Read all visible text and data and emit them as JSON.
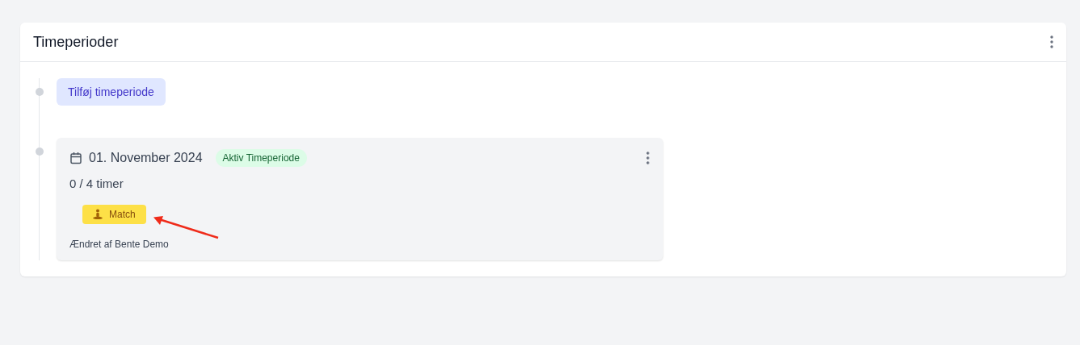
{
  "panel": {
    "title": "Timeperioder"
  },
  "add_button": {
    "label": "Tilføj timeperiode"
  },
  "periods": [
    {
      "date": "01. November 2024",
      "status": "Aktiv Timeperiode",
      "hours": "0 / 4 timer",
      "tags": [
        {
          "label": "Match",
          "kind": "match"
        }
      ],
      "changed_by": "Ændret af Bente Demo",
      "annotated": true
    }
  ]
}
